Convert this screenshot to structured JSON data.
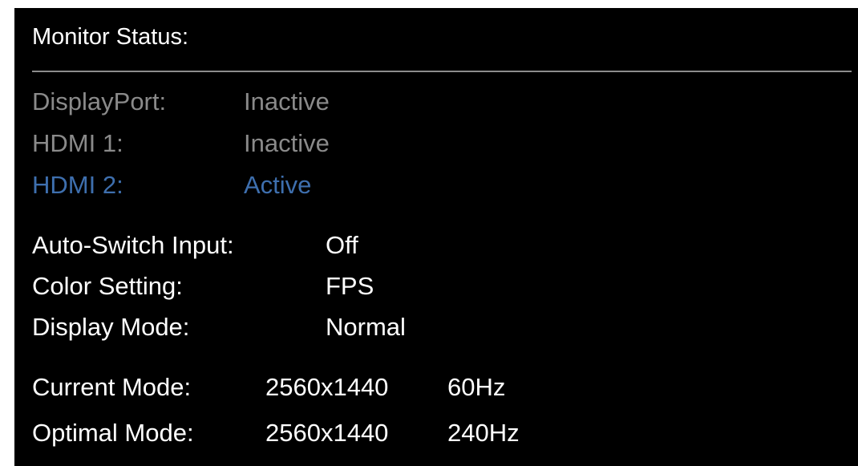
{
  "title": "Monitor Status:",
  "inputs": [
    {
      "label": "DisplayPort:",
      "value": "Inactive",
      "state": "inactive"
    },
    {
      "label": "HDMI 1:",
      "value": "Inactive",
      "state": "inactive"
    },
    {
      "label": "HDMI 2:",
      "value": "Active",
      "state": "active"
    }
  ],
  "settings": [
    {
      "label": "Auto-Switch Input:",
      "value": "Off"
    },
    {
      "label": "Color Setting:",
      "value": "FPS"
    },
    {
      "label": "Display Mode:",
      "value": "Normal"
    }
  ],
  "modes": [
    {
      "label": "Current Mode:",
      "resolution": "2560x1440",
      "refresh": "60Hz"
    },
    {
      "label": "Optimal Mode:",
      "resolution": "2560x1440",
      "refresh": "240Hz"
    }
  ],
  "colors": {
    "background": "#000000",
    "text": "#ffffff",
    "inactive": "#8a8a8a",
    "active": "#3e6fae",
    "divider": "#8c8c8c"
  }
}
